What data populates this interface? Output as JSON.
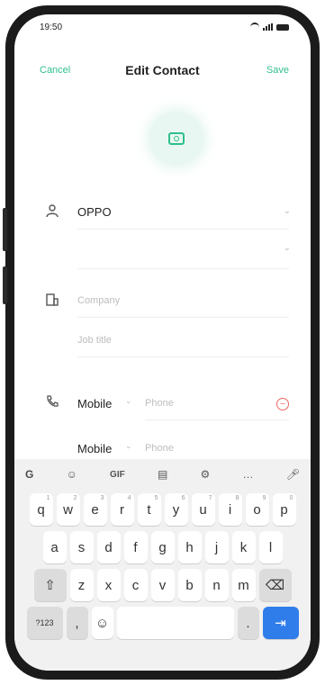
{
  "status": {
    "time": "19:50"
  },
  "nav": {
    "cancel": "Cancel",
    "title": "Edit Contact",
    "save": "Save"
  },
  "name": {
    "value": "OPPO"
  },
  "company": {
    "placeholder": "Company",
    "title_placeholder": "Job title"
  },
  "phone1": {
    "label": "Mobile",
    "placeholder": "Phone"
  },
  "phone2": {
    "label": "Mobile",
    "placeholder": "Phone"
  },
  "keyboard": {
    "toolbar": [
      "G",
      "sticker",
      "GIF",
      "clipboard",
      "settings",
      "...",
      "mic"
    ],
    "row1": [
      {
        "k": "q",
        "h": "1"
      },
      {
        "k": "w",
        "h": "2"
      },
      {
        "k": "e",
        "h": "3"
      },
      {
        "k": "r",
        "h": "4"
      },
      {
        "k": "t",
        "h": "5"
      },
      {
        "k": "y",
        "h": "6"
      },
      {
        "k": "u",
        "h": "7"
      },
      {
        "k": "i",
        "h": "8"
      },
      {
        "k": "o",
        "h": "9"
      },
      {
        "k": "p",
        "h": "0"
      }
    ],
    "row2": [
      "a",
      "s",
      "d",
      "f",
      "g",
      "h",
      "j",
      "k",
      "l"
    ],
    "row3": [
      "z",
      "x",
      "c",
      "v",
      "b",
      "n",
      "m"
    ],
    "row4": {
      "sym": "?123",
      "comma": ",",
      "period": "."
    }
  }
}
